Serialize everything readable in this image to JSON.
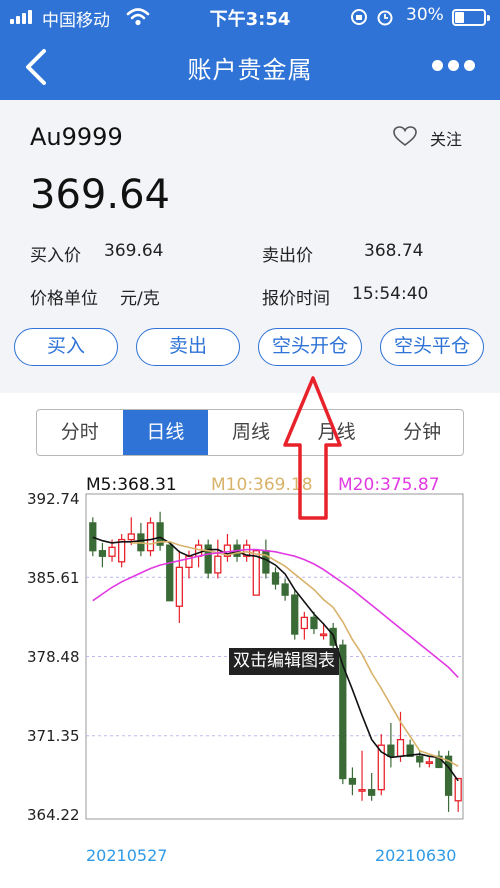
{
  "status_bar": {
    "carrier": "中国移动",
    "time": "下午3:54",
    "battery": "30%",
    "battery_level": 0.3
  },
  "header": {
    "title": "账户贵金属",
    "back_icon": "chevron-left-icon",
    "more_icon": "more-dots-icon"
  },
  "quote": {
    "symbol": "Au9999",
    "follow_label": "关注",
    "price": "369.64",
    "buy_label": "买入价",
    "buy_value": "369.64",
    "sell_label": "卖出价",
    "sell_value": "368.74",
    "unit_label": "价格单位",
    "unit_value": "元/克",
    "time_label": "报价时间",
    "time_value": "15:54:40"
  },
  "actions": [
    "买入",
    "卖出",
    "空头开仓",
    "空头平仓"
  ],
  "tabs": {
    "items": [
      "分时",
      "日线",
      "周线",
      "月线",
      "分钟"
    ],
    "active_index": 1
  },
  "chart": {
    "overlay_text": "双击编辑图表",
    "colors": {
      "up": "#e8222b",
      "down": "#3a6b36",
      "m5": "#111111",
      "m10": "#d9b26a",
      "m20": "#e13ae2",
      "accent": "#2f73d6"
    }
  },
  "chart_data": {
    "type": "candlestick",
    "legend": [
      {
        "name": "M5",
        "value": "368.31",
        "color": "#111111"
      },
      {
        "name": "M10",
        "value": "369.18",
        "color": "#d9b26a"
      },
      {
        "name": "M20",
        "value": "375.87",
        "color": "#e13ae2"
      }
    ],
    "y_ticks": [
      "392.74",
      "385.61",
      "378.48",
      "371.35",
      "364.22"
    ],
    "ylim": [
      364.22,
      392.74
    ],
    "x_labels": [
      "20210527",
      "20210630"
    ],
    "candles": [
      [
        390.5,
        391.0,
        387.5,
        388.0
      ],
      [
        388.0,
        388.7,
        386.5,
        387.5
      ],
      [
        387.5,
        389.0,
        387.0,
        388.3
      ],
      [
        387.0,
        389.5,
        386.5,
        389.0
      ],
      [
        389.0,
        391.0,
        388.5,
        389.5
      ],
      [
        389.5,
        390.5,
        387.5,
        388.0
      ],
      [
        388.0,
        391.0,
        387.5,
        390.5
      ],
      [
        390.5,
        391.5,
        388.0,
        388.5
      ],
      [
        388.5,
        388.5,
        383.5,
        383.5
      ],
      [
        383.0,
        388.0,
        381.5,
        386.5
      ],
      [
        386.5,
        388.0,
        385.5,
        387.5
      ],
      [
        387.5,
        389.0,
        386.5,
        388.5
      ],
      [
        388.5,
        389.0,
        385.5,
        386.0
      ],
      [
        386.0,
        389.0,
        385.5,
        387.5
      ],
      [
        387.5,
        389.5,
        387.0,
        388.5
      ],
      [
        388.5,
        389.0,
        387.0,
        387.5
      ],
      [
        387.5,
        389.0,
        387.0,
        388.5
      ],
      [
        384.0,
        388.0,
        384.0,
        388.0
      ],
      [
        388.0,
        389.0,
        385.5,
        386.0
      ],
      [
        386.0,
        386.5,
        384.5,
        385.0
      ],
      [
        385.0,
        385.5,
        383.5,
        384.0
      ],
      [
        384.0,
        384.5,
        380.0,
        380.5
      ],
      [
        381.0,
        382.5,
        380.0,
        382.0
      ],
      [
        382.0,
        382.5,
        380.5,
        381.0
      ],
      [
        380.5,
        381.5,
        380.0,
        380.5
      ],
      [
        381.0,
        381.5,
        379.0,
        379.5
      ],
      [
        379.5,
        380.0,
        367.0,
        367.5
      ],
      [
        367.5,
        368.5,
        366.0,
        367.0
      ],
      [
        366.5,
        370.0,
        365.5,
        366.5
      ],
      [
        366.5,
        368.0,
        365.5,
        366.0
      ],
      [
        366.5,
        371.5,
        366.0,
        370.5
      ],
      [
        370.5,
        372.5,
        368.5,
        369.5
      ],
      [
        369.5,
        373.5,
        369.0,
        371.0
      ],
      [
        370.5,
        371.0,
        369.5,
        369.5
      ],
      [
        369.5,
        370.0,
        368.5,
        369.0
      ],
      [
        369.0,
        369.5,
        368.5,
        369.0
      ],
      [
        369.5,
        370.0,
        368.5,
        368.5
      ],
      [
        369.5,
        370.0,
        364.5,
        366.0
      ],
      [
        365.5,
        367.5,
        364.5,
        367.5
      ]
    ],
    "series": [
      {
        "name": "M5",
        "values": [
          389.2,
          388.9,
          388.7,
          388.8,
          388.8,
          388.9,
          389.0,
          389.2,
          388.7,
          387.9,
          387.5,
          387.8,
          388.1,
          388.1,
          387.7,
          387.9,
          387.6,
          387.5,
          387.2,
          386.7,
          385.9,
          384.5,
          383.4,
          382.3,
          381.4,
          380.4,
          377.7,
          375.5,
          373.2,
          371.0,
          369.9,
          369.4,
          369.5,
          369.6,
          369.7,
          369.5,
          369.4,
          368.5,
          367.3
        ]
      },
      {
        "name": "M10",
        "values": [
          null,
          null,
          null,
          null,
          388.7,
          388.7,
          388.6,
          388.8,
          388.8,
          388.5,
          388.3,
          388.1,
          388.0,
          387.8,
          387.6,
          387.8,
          387.9,
          387.7,
          387.6,
          387.1,
          386.6,
          385.9,
          385.2,
          384.5,
          383.6,
          382.9,
          381.6,
          380.0,
          378.7,
          377.0,
          375.6,
          374.1,
          372.6,
          371.3,
          370.0,
          369.7,
          369.4,
          369.1,
          368.6
        ]
      },
      {
        "name": "M20",
        "values": [
          383.5,
          384.1,
          384.7,
          385.2,
          385.6,
          386.0,
          386.4,
          386.7,
          386.9,
          387.1,
          387.3,
          387.5,
          387.7,
          387.8,
          387.9,
          388.0,
          388.1,
          388.1,
          388.0,
          387.9,
          387.7,
          387.5,
          387.2,
          386.8,
          386.3,
          385.7,
          385.1,
          384.5,
          383.8,
          383.1,
          382.4,
          381.7,
          381.0,
          380.3,
          379.6,
          378.9,
          378.2,
          377.5,
          376.6
        ]
      }
    ]
  }
}
